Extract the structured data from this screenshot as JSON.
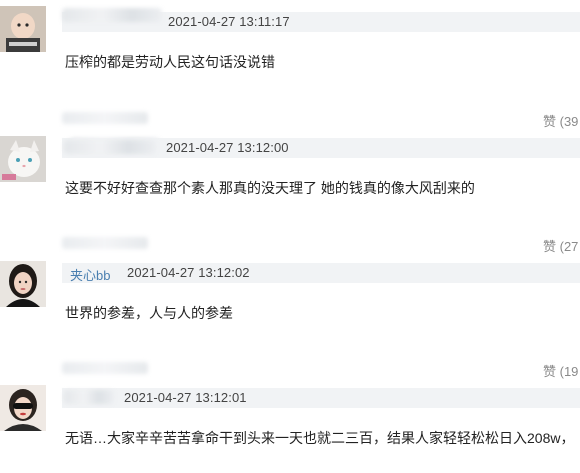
{
  "comments": [
    {
      "avatar": "baby-avatar",
      "username": "",
      "timestamp": "2021-04-27 13:11:17",
      "text": "压榨的都是劳动人民这句话没说错",
      "like_label": "赞 (39"
    },
    {
      "avatar": "white-cat-avatar",
      "username": "",
      "timestamp": "2021-04-27 13:12:00",
      "text": "这要不好好查查那个素人那真的没天理了 她的钱真的像大风刮来的",
      "like_label": "赞 (27"
    },
    {
      "avatar": "woman-dark-hair-avatar",
      "username": "夹心bb",
      "timestamp": "2021-04-27 13:12:02",
      "text": "世界的参差，人与人的参差",
      "like_label": "赞 (19"
    },
    {
      "avatar": "sunglasses-woman-avatar",
      "username": "",
      "timestamp": "2021-04-27 13:12:01",
      "text": "无语…大家辛辛苦苦拿命干到头来一天也就二三百，结果人家轻轻松松日入208w，",
      "like_label": ""
    }
  ],
  "colors": {
    "meta_bar": "#f1f3f5",
    "username": "#4a7fb0",
    "text": "#222222",
    "like": "#8a8a8a"
  }
}
